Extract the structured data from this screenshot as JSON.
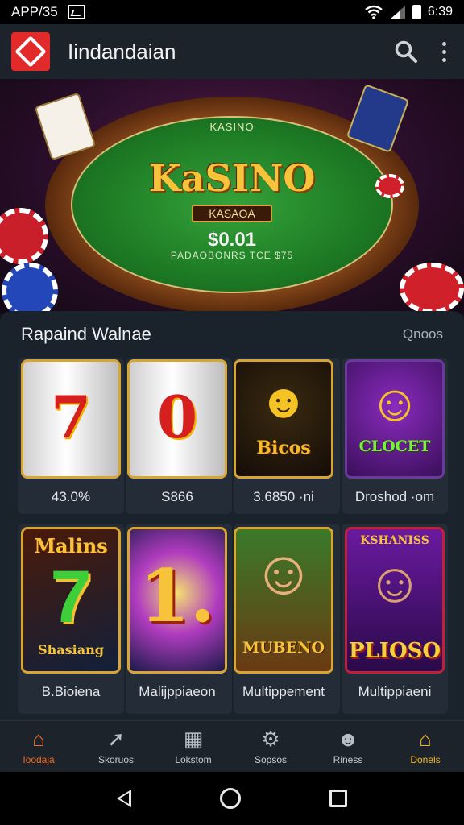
{
  "status_bar": {
    "left_text": "APP/35",
    "time": "6:39"
  },
  "app_bar": {
    "title": "Iindandaian",
    "search_icon": "search-icon",
    "menu_icon": "more-vert-icon"
  },
  "hero": {
    "felt_top_text": "KASINO",
    "title": "KaSINO",
    "plate_text": "KASAOA",
    "amount": "$0.01",
    "caption": "PADAOBONRS TCE $75"
  },
  "section": {
    "title": "Rapaind Walnae",
    "link": "Qnoos"
  },
  "games_row1": [
    {
      "label": "43.0%",
      "symbol": "7"
    },
    {
      "label": "S866",
      "symbol": "0"
    },
    {
      "label": "3.6850 ·ni",
      "thumb_text": "Bicos"
    },
    {
      "label": "Droshod ·om",
      "thumb_text": "CLOCET"
    }
  ],
  "games_row2": [
    {
      "label": "B.Bioiena",
      "thumb_top": "Malins",
      "thumb_bottom": "Shasiang"
    },
    {
      "label": "Malijppiaeon",
      "thumb_text": "1."
    },
    {
      "label": "Multippement",
      "thumb_text": "MUBENO"
    },
    {
      "label": "Multippiaeni",
      "thumb_top": "KSHANISS",
      "thumb_text": "PLIOSO"
    }
  ],
  "bottom_nav": [
    {
      "label": "Ioodaja",
      "icon": "home-icon",
      "active": true
    },
    {
      "label": "Skoruos",
      "icon": "rocket-icon",
      "active": false
    },
    {
      "label": "Lokstom",
      "icon": "grid-icon",
      "active": false
    },
    {
      "label": "Sopsos",
      "icon": "gear-icon",
      "active": false
    },
    {
      "label": "Riness",
      "icon": "profile-icon",
      "active": false
    },
    {
      "label": "Donels",
      "icon": "store-icon",
      "active": true
    }
  ],
  "colors": {
    "accent": "#f5a623",
    "active_nav": "#f26a1b",
    "panel": "#1a222c"
  }
}
